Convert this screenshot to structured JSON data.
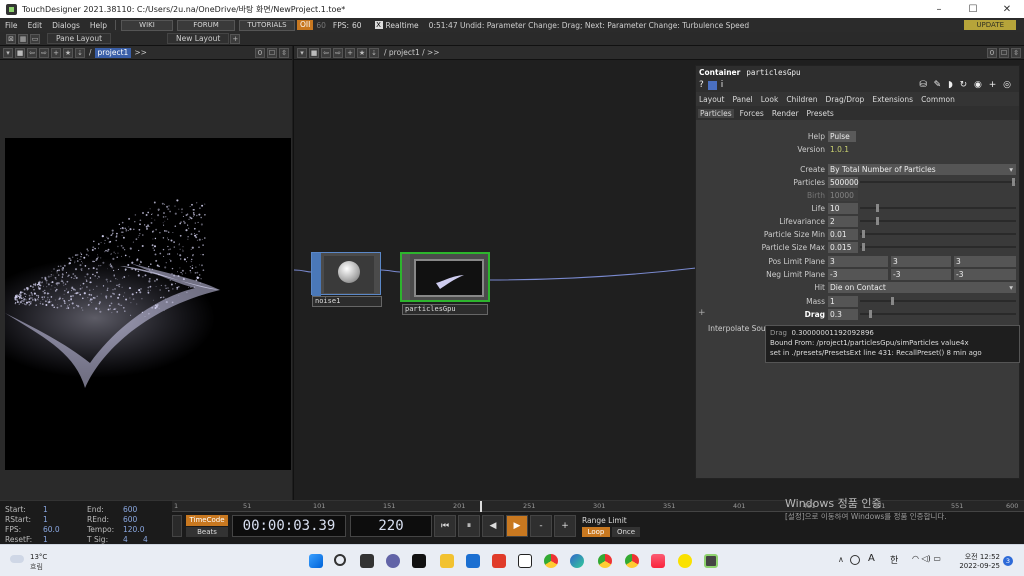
{
  "window": {
    "title": "TouchDesigner 2021.38110: C:/Users/2u.na/OneDrive/바탕 화면/NewProject.1.toe*",
    "minimize": "–",
    "maximize": "☐",
    "close": "✕"
  },
  "menu": {
    "items": [
      "File",
      "Edit",
      "Dialogs",
      "Help"
    ],
    "wiki": "WIKI",
    "forum": "FORUM",
    "tutorials": "TUTORIALS",
    "oii": "OII",
    "sixty": "60",
    "fps_label": "FPS:",
    "fps_value": "60",
    "realtime_check": "X",
    "realtime": "Realtime",
    "status": "0:51:47 Undid: Parameter Change: Drag; Next: Parameter Change: Turbulence Speed",
    "update": "UPDATE"
  },
  "panebar": {
    "pane_layout": "Pane Layout",
    "new_layout": "New Layout",
    "plus": "+"
  },
  "left_pane": {
    "path_sep": "/",
    "project": "project1",
    "arrows": ">>",
    "zero": "0"
  },
  "network_pane": {
    "path": "/ project1 / >>",
    "zero": "0"
  },
  "nodes": {
    "noise": {
      "name": "noise1"
    },
    "particles": {
      "name": "particlesGpu"
    }
  },
  "params": {
    "container_label": "Container",
    "name": "particlesGpu",
    "help_icon": "?",
    "info_icon": "i",
    "tabs": [
      "Layout",
      "Panel",
      "Look",
      "Children",
      "Drag/Drop",
      "Extensions",
      "Common"
    ],
    "subtabs": [
      "Particles",
      "Forces",
      "Render",
      "Presets"
    ],
    "rows": {
      "help": {
        "label": "Help",
        "value": "Pulse"
      },
      "version": {
        "label": "Version",
        "value": "1.0.1"
      },
      "create": {
        "label": "Create",
        "value": "By Total Number of Particles"
      },
      "particles": {
        "label": "Particles",
        "value": "500000"
      },
      "birth": {
        "label": "Birth",
        "value": "10000"
      },
      "life": {
        "label": "Life",
        "value": "10"
      },
      "lifevariance": {
        "label": "Lifevariance",
        "value": "2"
      },
      "psizemin": {
        "label": "Particle Size Min",
        "value": "0.01"
      },
      "psizemax": {
        "label": "Particle Size Max",
        "value": "0.015"
      },
      "poslimit": {
        "label": "Pos Limit Plane",
        "values": [
          "3",
          "3",
          "3"
        ]
      },
      "neglimit": {
        "label": "Neg Limit Plane",
        "values": [
          "-3",
          "-3",
          "-3"
        ]
      },
      "hit": {
        "label": "Hit",
        "value": "Die on Contact"
      },
      "mass": {
        "label": "Mass",
        "value": "1"
      },
      "drag": {
        "label": "Drag",
        "value": "0.3"
      },
      "interp": {
        "label": "Interpolate Sour"
      }
    }
  },
  "tooltip": {
    "line1_label": "Drag",
    "line1_value": "0.30000001192092896",
    "line2": "Bound From: /project1/particlesGpu/simParticles value4x",
    "line3": "set in ./presets/PresetsExt line 431: RecallPreset() 8 min ago"
  },
  "stats": {
    "start_label": "Start:",
    "start": "1",
    "end_label": "End:",
    "end": "600",
    "rstart_label": "RStart:",
    "rstart": "1",
    "rend_label": "REnd:",
    "rend": "600",
    "fps_label": "FPS:",
    "fps": "60.0",
    "tempo_label": "Tempo:",
    "tempo": "120.0",
    "resetf_label": "ResetF:",
    "resetf": "1",
    "tsig_label": "T Sig:",
    "tsig_a": "4",
    "tsig_b": "4"
  },
  "timeline": {
    "ruler": [
      "1",
      "51",
      "101",
      "151",
      "201",
      "251",
      "301",
      "351",
      "401",
      "451",
      "501",
      "551",
      "600"
    ],
    "timecode_btn": "TimeCode",
    "beats_btn": "Beats",
    "timecode": "00:00:03.39",
    "frame": "220",
    "range_limit": "Range Limit",
    "loop": "Loop",
    "once": "Once",
    "minus": "-",
    "plus": "+"
  },
  "watermark": {
    "line1": "Windows 정품 인증",
    "line2": "[설정]으로 이동하여 Windows를 정품 인증합니다."
  },
  "taskbar": {
    "weather_temp": "13°C",
    "weather_desc": "흐림",
    "lang_a": "A",
    "lang_ko": "한",
    "time": "오전 12:52",
    "date": "2022-09-25",
    "notif": "3"
  }
}
